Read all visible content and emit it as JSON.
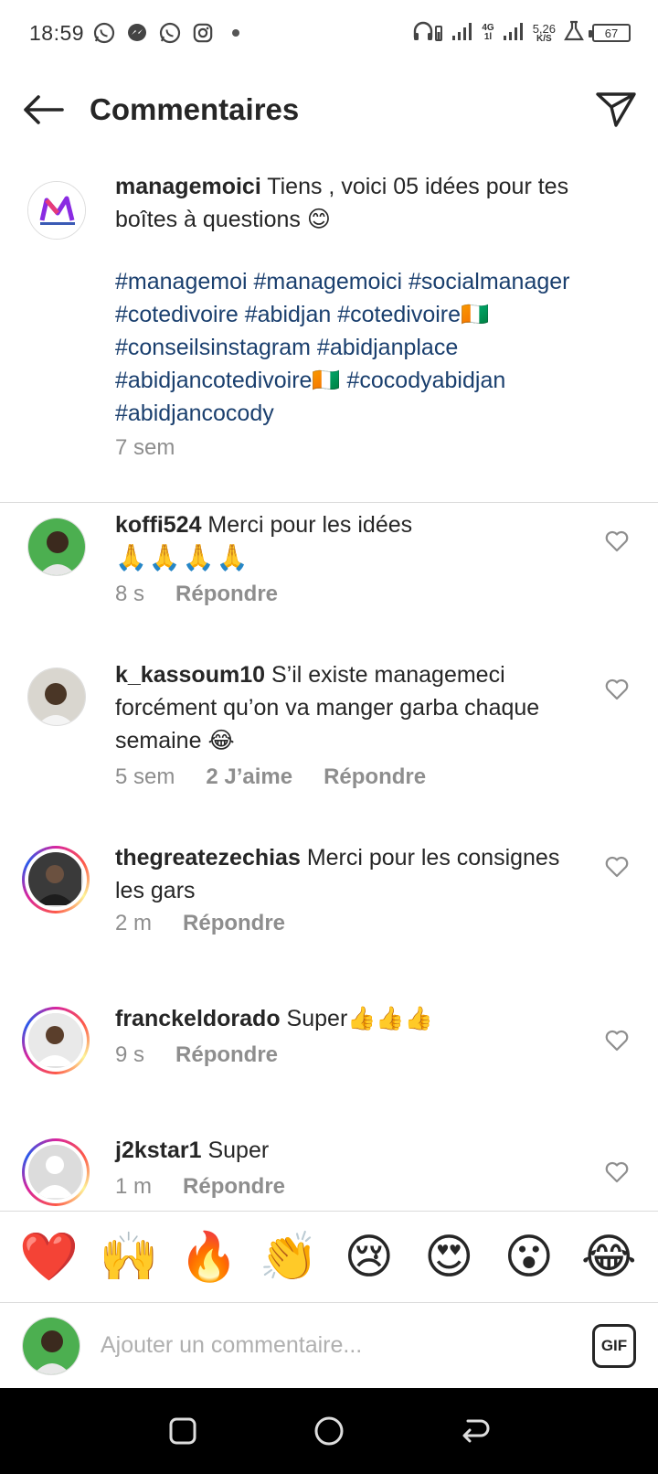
{
  "status_bar": {
    "time": "18:59",
    "apps": [
      "whatsapp-icon",
      "messenger-icon",
      "whatsapp-icon",
      "instagram-icon"
    ],
    "network_top": "4G",
    "network_bottom": "1l",
    "speed_value": "5,26",
    "speed_unit": "K/S",
    "battery": "67"
  },
  "header": {
    "title": "Commentaires"
  },
  "caption": {
    "username": "managemoici",
    "text_line": " Tiens , voici 05 idées pour tes boîtes à questions 😊",
    "hashtags": "#managemoi #managemoici #socialmanager #cotedivoire #abidjan #cotedivoire🇨🇮 #conseilsinstagram #abidjanplace #abidjancotedivoire🇨🇮 #cocodyabidjan #abidjancocody",
    "time": "7 sem"
  },
  "comments": [
    {
      "username": "koffi524",
      "text": " Merci pour les idées",
      "extra": "🙏🙏🙏🙏",
      "time": "8 s",
      "likes": "",
      "reply": "Répondre"
    },
    {
      "username": "k_kassoum10",
      "text": " S’il existe managemeci forcément qu’on va manger garba chaque semaine 😂",
      "extra": "",
      "time": "5 sem",
      "likes": "2 J’aime",
      "reply": "Répondre"
    },
    {
      "username": "thegreatezechias",
      "text": " Merci pour les consignes les gars",
      "extra": "",
      "time": "2 m",
      "likes": "",
      "reply": "Répondre"
    },
    {
      "username": "franckeldorado",
      "text": " Super👍👍👍",
      "extra": "",
      "time": "9 s",
      "likes": "",
      "reply": "Répondre"
    },
    {
      "username": "j2kstar1",
      "text": " Super",
      "extra": "",
      "time": "1 m",
      "likes": "",
      "reply": "Répondre"
    }
  ],
  "emoji_bar": [
    "❤️",
    "🙌",
    "🔥",
    "👏",
    "😢",
    "😍",
    "😮",
    "😂"
  ],
  "composer": {
    "placeholder": "Ajouter un commentaire...",
    "gif_label": "GIF"
  },
  "colors": {
    "hashtag": "#1a3f6e",
    "meta": "#8e8e8e",
    "divider": "#dbdbdb"
  }
}
